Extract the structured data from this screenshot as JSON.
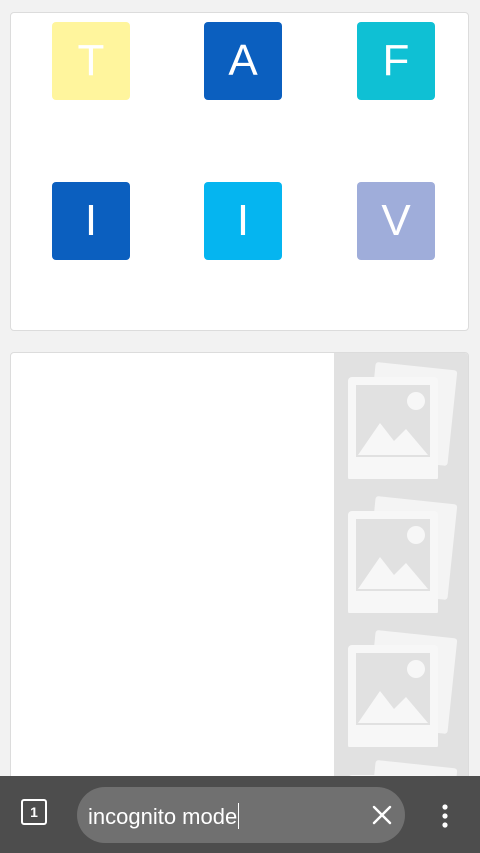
{
  "tiles": [
    {
      "letter": "T",
      "color": "#fff59d"
    },
    {
      "letter": "A",
      "color": "#0b5fbf"
    },
    {
      "letter": "F",
      "color": "#0fc0d4"
    },
    {
      "letter": "I",
      "color": "#0b5fbf"
    },
    {
      "letter": "I",
      "color": "#05b5f0"
    },
    {
      "letter": "V",
      "color": "#9fadda"
    }
  ],
  "placeholder_icon": "image-placeholder-icon",
  "toolbar": {
    "tab_count": "1",
    "omnibox_text": "incognito mode",
    "clear_icon": "close-icon",
    "menu_icon": "more-vert-icon"
  }
}
